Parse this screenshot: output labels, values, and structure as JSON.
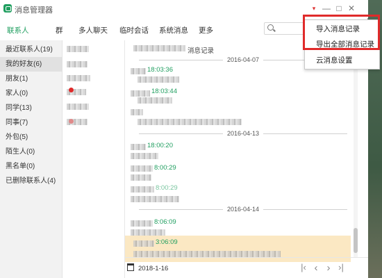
{
  "app": {
    "title": "消息管理器"
  },
  "window_controls": {
    "menu_arrow": "▾",
    "minimize": "—",
    "maximize": "□",
    "close": "✕"
  },
  "tabs": [
    {
      "label": "联系人",
      "active": true
    },
    {
      "label": "群"
    },
    {
      "label": "多人聊天"
    },
    {
      "label": "临时会话"
    },
    {
      "label": "系统消息"
    },
    {
      "label": "更多"
    }
  ],
  "sidebar": {
    "items": [
      {
        "label": "最近联系人(19)"
      },
      {
        "label": "我的好友(6)",
        "selected": true
      },
      {
        "label": "朋友(1)"
      },
      {
        "label": "家人(0)"
      },
      {
        "label": "同学(13)"
      },
      {
        "label": "同事(7)"
      },
      {
        "label": "外包(5)"
      },
      {
        "label": "陌生人(0)"
      },
      {
        "label": "黑名单(0)"
      },
      {
        "label": "已删除联系人(4)"
      }
    ]
  },
  "messages": {
    "title_suffix": "消息记录",
    "dates": [
      "2016-04-07",
      "2016-04-13",
      "2016-04-14"
    ],
    "times": [
      "18:03:36",
      "18:03:44",
      "18:00:20",
      "8:00:29",
      "8:00:29",
      "8:06:09",
      "3:06:09"
    ]
  },
  "footer": {
    "date": "2018-1-16",
    "first": "|‹",
    "prev": "‹",
    "next": "›",
    "last": "›|"
  },
  "dropdown_menu": {
    "items": [
      "导入消息记录",
      "导出全部消息记录",
      "云消息设置"
    ]
  },
  "colors": {
    "accent_green": "#1f9e5f",
    "highlight_red": "#e02a2a",
    "selected_row": "#fbe8c3"
  }
}
